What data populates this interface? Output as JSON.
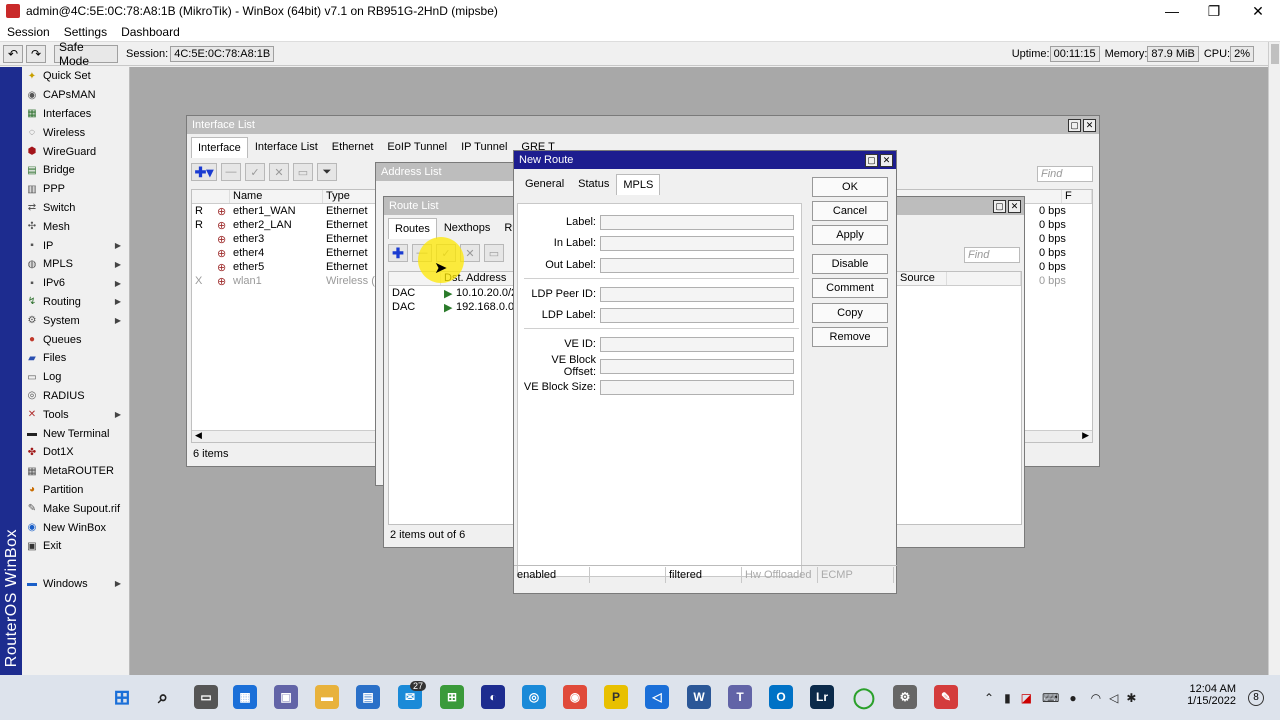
{
  "window": {
    "title": "admin@4C:5E:0C:78:A8:1B (MikroTik) - WinBox (64bit) v7.1 on RB951G-2HnD (mipsbe)",
    "minimize": "—",
    "maximize": "❐",
    "close": "✕"
  },
  "menu": [
    "Session",
    "Settings",
    "Dashboard"
  ],
  "toolbar": {
    "undo_icon": "↶",
    "redo_icon": "↷",
    "safe_mode": "Safe Mode",
    "session_label": "Session:",
    "session_value": "4C:5E:0C:78:A8:1B",
    "uptime_label": "Uptime:",
    "uptime_value": "00:11:15",
    "memory_label": "Memory:",
    "memory_value": "87.9 MiB",
    "cpu_label": "CPU:",
    "cpu_value": "2%"
  },
  "brand_strip": "RouterOS WinBox",
  "sidebar": [
    {
      "label": "Quick Set",
      "icon": "quickset-icon",
      "glyph": "✦",
      "color": "#c8a000",
      "submenu": false
    },
    {
      "label": "CAPsMAN",
      "icon": "capsman-icon",
      "glyph": "◉",
      "color": "#555",
      "submenu": false
    },
    {
      "label": "Interfaces",
      "icon": "interfaces-icon",
      "glyph": "▦",
      "color": "#2a6e2a",
      "submenu": false
    },
    {
      "label": "Wireless",
      "icon": "wireless-icon",
      "glyph": "◌",
      "color": "#444",
      "submenu": false
    },
    {
      "label": "WireGuard",
      "icon": "wireguard-icon",
      "glyph": "⬢",
      "color": "#a3141a",
      "submenu": false
    },
    {
      "label": "Bridge",
      "icon": "bridge-icon",
      "glyph": "▤",
      "color": "#2a6e2a",
      "submenu": false
    },
    {
      "label": "PPP",
      "icon": "ppp-icon",
      "glyph": "▥",
      "color": "#555",
      "submenu": false
    },
    {
      "label": "Switch",
      "icon": "switch-icon",
      "glyph": "⇄",
      "color": "#555",
      "submenu": false
    },
    {
      "label": "Mesh",
      "icon": "mesh-icon",
      "glyph": "✣",
      "color": "#555",
      "submenu": false
    },
    {
      "label": "IP",
      "icon": "ip-icon",
      "glyph": "▪",
      "color": "#555",
      "submenu": true
    },
    {
      "label": "MPLS",
      "icon": "mpls-icon",
      "glyph": "◍",
      "color": "#555",
      "submenu": true
    },
    {
      "label": "IPv6",
      "icon": "ipv6-icon",
      "glyph": "▪",
      "color": "#555",
      "submenu": true
    },
    {
      "label": "Routing",
      "icon": "routing-icon",
      "glyph": "↯",
      "color": "#2a6e2a",
      "submenu": true
    },
    {
      "label": "System",
      "icon": "system-icon",
      "glyph": "⚙",
      "color": "#555",
      "submenu": true
    },
    {
      "label": "Queues",
      "icon": "queues-icon",
      "glyph": "●",
      "color": "#c0392b",
      "submenu": false
    },
    {
      "label": "Files",
      "icon": "files-icon",
      "glyph": "▰",
      "color": "#2a4fb0",
      "submenu": false
    },
    {
      "label": "Log",
      "icon": "log-icon",
      "glyph": "▭",
      "color": "#555",
      "submenu": false
    },
    {
      "label": "RADIUS",
      "icon": "radius-icon",
      "glyph": "◎",
      "color": "#555",
      "submenu": false
    },
    {
      "label": "Tools",
      "icon": "tools-icon",
      "glyph": "✕",
      "color": "#b03030",
      "submenu": true
    },
    {
      "label": "New Terminal",
      "icon": "terminal-icon",
      "glyph": "▬",
      "color": "#222",
      "submenu": false
    },
    {
      "label": "Dot1X",
      "icon": "dot1x-icon",
      "glyph": "✤",
      "color": "#a01818",
      "submenu": false
    },
    {
      "label": "MetaROUTER",
      "icon": "metarouter-icon",
      "glyph": "▦",
      "color": "#555",
      "submenu": false
    },
    {
      "label": "Partition",
      "icon": "partition-icon",
      "glyph": "◕",
      "color": "#c86c00",
      "submenu": false
    },
    {
      "label": "Make Supout.rif",
      "icon": "supout-icon",
      "glyph": "✎",
      "color": "#555",
      "submenu": false
    },
    {
      "label": "New WinBox",
      "icon": "winbox-icon",
      "glyph": "◉",
      "color": "#1a5fc8",
      "submenu": false
    },
    {
      "label": "Exit",
      "icon": "exit-icon",
      "glyph": "▣",
      "color": "#333",
      "submenu": false
    },
    {
      "label": "",
      "icon": "",
      "glyph": "",
      "color": "#555",
      "submenu": false
    },
    {
      "label": "Windows",
      "icon": "windows-icon",
      "glyph": "▬",
      "color": "#1a5fc8",
      "submenu": true
    }
  ],
  "interface_list": {
    "title": "Interface List",
    "tabs": [
      "Interface",
      "Interface List",
      "Ethernet",
      "EoIP Tunnel",
      "IP Tunnel",
      "GRE T"
    ],
    "find_placeholder": "Find",
    "columns": [
      "Name",
      "Type"
    ],
    "rows": [
      {
        "flag": "R",
        "name": "ether1_WAN",
        "type": "Ethernet",
        "rate": "0 bps",
        "disabled": false
      },
      {
        "flag": "R",
        "name": "ether2_LAN",
        "type": "Ethernet",
        "rate": "0 bps",
        "disabled": false
      },
      {
        "flag": "",
        "name": "ether3",
        "type": "Ethernet",
        "rate": "0 bps",
        "disabled": false
      },
      {
        "flag": "",
        "name": "ether4",
        "type": "Ethernet",
        "rate": "0 bps",
        "disabled": false
      },
      {
        "flag": "",
        "name": "ether5",
        "type": "Ethernet",
        "rate": "0 bps",
        "disabled": false
      },
      {
        "flag": "X",
        "name": "wlan1",
        "type": "Wireless (A",
        "rate": "0 bps",
        "disabled": true
      }
    ],
    "status": "6 items",
    "rate_col_head": "F"
  },
  "address_list": {
    "title": "Address List"
  },
  "route_list": {
    "title": "Route List",
    "tabs": [
      "Routes",
      "Nexthops",
      "Rule"
    ],
    "find_placeholder": "Find",
    "columns": [
      "Dst. Address"
    ],
    "rows": [
      {
        "flag": "DAC",
        "dst": "10.10.20.0/2"
      },
      {
        "flag": "DAC",
        "dst": "192.168.0.0/"
      }
    ],
    "source_col": "Source",
    "status": "2 items out of 6"
  },
  "new_route": {
    "title": "New Route",
    "tabs": [
      "General",
      "Status",
      "MPLS"
    ],
    "fields": [
      "Label:",
      "In Label:",
      "Out Label:",
      "LDP Peer ID:",
      "LDP Label:",
      "VE ID:",
      "VE Block Offset:",
      "VE Block Size:"
    ],
    "buttons": [
      "OK",
      "Cancel",
      "Apply",
      "Disable",
      "Comment",
      "Copy",
      "Remove"
    ],
    "status": [
      "enabled",
      "",
      "filtered",
      "Hw Offloaded",
      "ECMP"
    ]
  },
  "taskbar": {
    "badge_count": "27",
    "time": "12:04 AM",
    "date": "1/15/2022",
    "notif_count": "8"
  }
}
